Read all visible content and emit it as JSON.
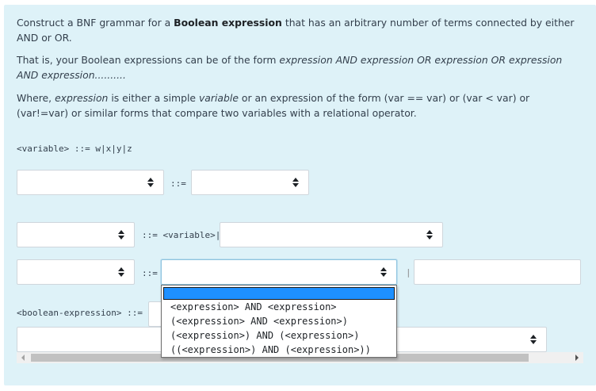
{
  "question": {
    "p1_part1": "Construct a BNF grammar for a ",
    "p1_bold": "Boolean expression",
    "p1_part2": " that has an arbitrary number of terms connected by either AND or OR.",
    "p2_part1": "That is, your Boolean expressions can be of the form ",
    "p2_italic": "expression AND expression OR expression OR expression AND expression..........",
    "p3_part1": "Where, ",
    "p3_italic1": "expression",
    "p3_part2": " is either a simple ",
    "p3_italic2": "variable",
    "p3_part3": " or an expression of the form (var == var) or (var < var) or (var!=var) or similar forms that compare two variables with a relational operator."
  },
  "grammar": {
    "variable_rule": "<variable> ::= w|x|y|z",
    "row1_sep": "::=",
    "row2_sep": "::= <variable>|",
    "row3_sep": "::=",
    "row3_pipe": "|",
    "boolean_label": "<boolean-expression> ::="
  },
  "dropdown": {
    "selected": "",
    "options": [
      "<expression> AND <expression>",
      "(<expression> AND <expression>)",
      "(<expression>) AND (<expression>)",
      "((<expression>) AND (<expression>))"
    ]
  },
  "colors": {
    "panel_bg": "#def2f8",
    "highlight": "#1e90ff"
  }
}
